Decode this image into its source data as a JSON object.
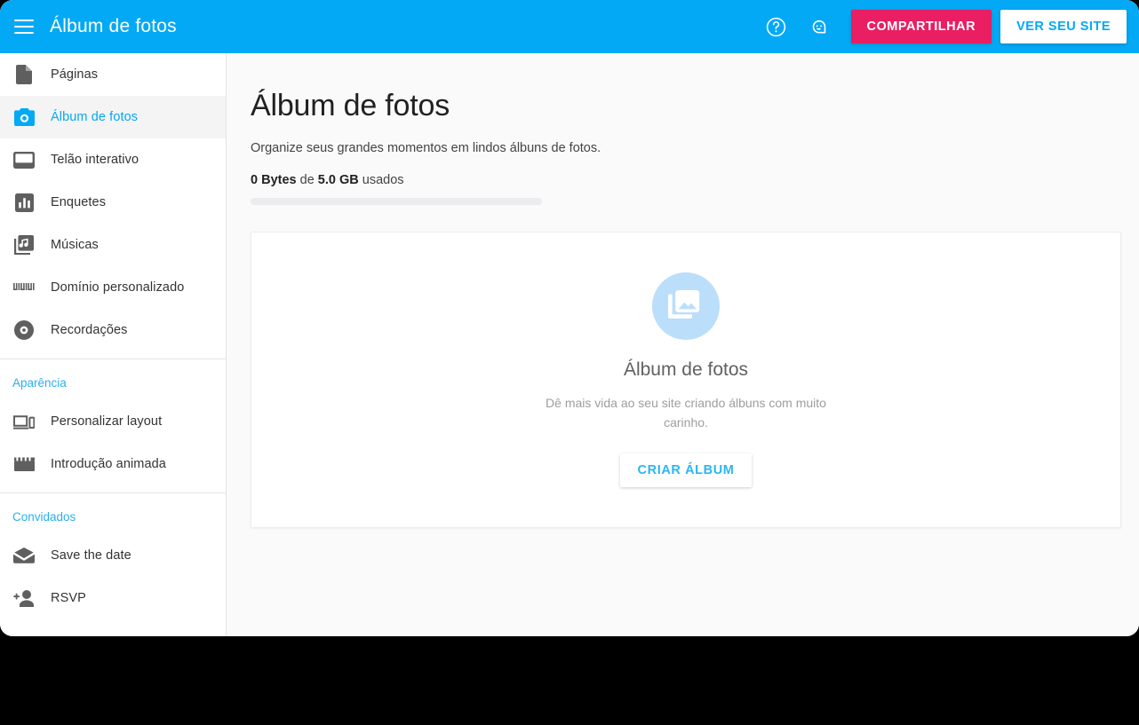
{
  "header": {
    "menu_icon": "hamburger-menu-icon",
    "title": "Álbum de fotos",
    "help_icon": "help-circle-icon",
    "account_icon": "account-face-icon",
    "share_label": "COMPARTILHAR",
    "view_site_label": "VER SEU SITE",
    "bg_color": "#03a9f4",
    "share_color": "#e91e63",
    "view_site_color": "#03a9f4"
  },
  "sidebar": {
    "items": [
      {
        "label": "Páginas",
        "icon": "document-icon",
        "active": false
      },
      {
        "label": "Álbum de fotos",
        "icon": "camera-icon",
        "active": true
      },
      {
        "label": "Telão interativo",
        "icon": "monitor-icon",
        "active": false
      },
      {
        "label": "Enquetes",
        "icon": "bar-chart-icon",
        "active": false
      },
      {
        "label": "Músicas",
        "icon": "music-note-icon",
        "active": false
      },
      {
        "label": "Domínio personalizado",
        "icon": "www-icon",
        "active": false
      },
      {
        "label": "Recordações",
        "icon": "disc-icon",
        "active": false
      }
    ],
    "groups": [
      {
        "title": "Aparência",
        "items": [
          {
            "label": "Personalizar layout",
            "icon": "devices-icon",
            "active": false
          },
          {
            "label": "Introdução animada",
            "icon": "clapperboard-icon",
            "active": false
          }
        ]
      },
      {
        "title": "Convidados",
        "items": [
          {
            "label": "Save the date",
            "icon": "envelope-icon",
            "active": false
          },
          {
            "label": "RSVP",
            "icon": "person-add-icon",
            "active": false
          }
        ]
      }
    ],
    "accent_color": "#29b0f0"
  },
  "main": {
    "page_title": "Álbum de fotos",
    "page_subtitle": "Organize seus grandes momentos em lindos álbuns de fotos.",
    "storage": {
      "used": "0 Bytes",
      "middle_text": "de",
      "total": "5.0 GB",
      "suffix": "usados",
      "percent": 0
    },
    "empty_state": {
      "icon": "photo-library-icon",
      "title": "Álbum de fotos",
      "description": "Dê mais vida ao seu site criando álbuns com muito carinho.",
      "button_label": "CRIAR ÁLBUM"
    }
  }
}
